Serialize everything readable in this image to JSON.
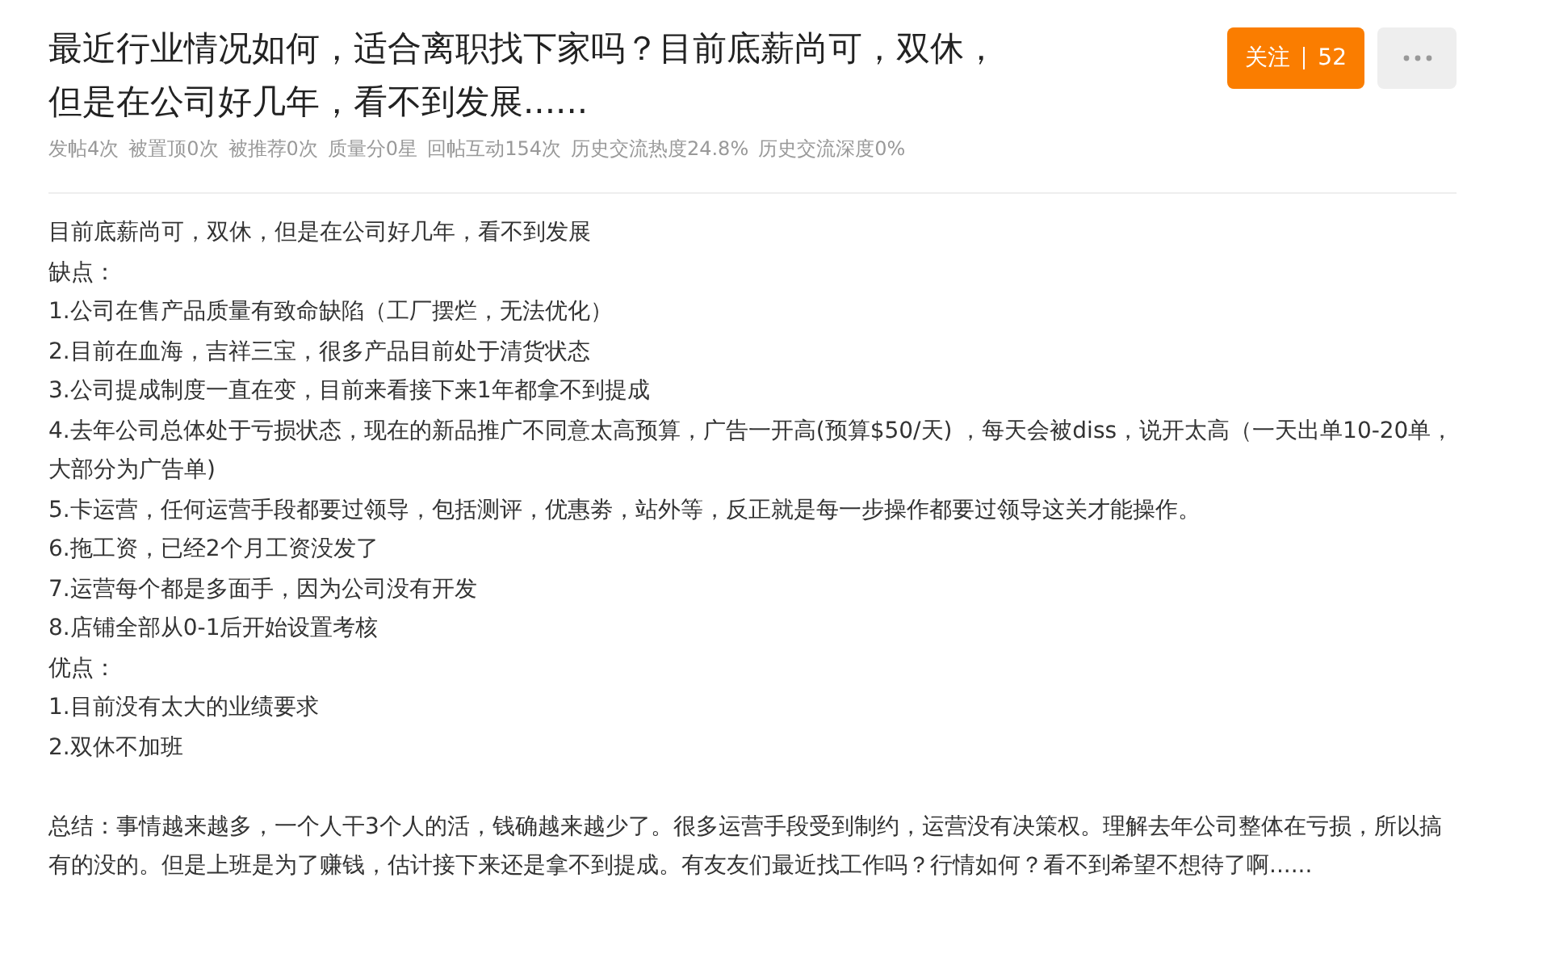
{
  "post": {
    "title": "最近行业情况如何，适合离职找下家吗？目前底薪尚可，双休，但是在公司好几年，看不到发展......",
    "stats": [
      "发帖4次",
      "被置顶0次",
      "被推荐0次",
      "质量分0星",
      "回帖互动154次",
      "历史交流热度24.8%",
      "历史交流深度0%"
    ],
    "follow_button": {
      "label": "关注",
      "count": "52"
    },
    "body": {
      "lines": [
        "目前底薪尚可，双休，但是在公司好几年，看不到发展",
        "缺点：",
        "1.公司在售产品质量有致命缺陷（工厂摆烂，无法优化）",
        "2.目前在血海，吉祥三宝，很多产品目前处于清货状态",
        "3.公司提成制度一直在变，目前来看接下来1年都拿不到提成",
        "4.去年公司总体处于亏损状态，现在的新品推广不同意太高预算，广告一开高(预算$50/天) ，每天会被diss，说开太高（一天出单10-20单，大部分为广告单)",
        "5.卡运营，任何运营手段都要过领导，包括测评，优惠劵，站外等，反正就是每一步操作都要过领导这关才能操作。",
        "6.拖工资，已经2个月工资没发了",
        "7.运营每个都是多面手，因为公司没有开发",
        "8.店铺全部从0-1后开始设置考核",
        "优点：",
        "1.目前没有太大的业绩要求",
        "2.双休不加班"
      ],
      "summary": "总结：事情越来越多，一个人干3个人的活，钱确越来越少了。很多运营手段受到制约，运营没有决策权。理解去年公司整体在亏损，所以搞有的没的。但是上班是为了赚钱，估计接下来还是拿不到提成。有友友们最近找工作吗？行情如何？看不到希望不想待了啊......"
    }
  }
}
